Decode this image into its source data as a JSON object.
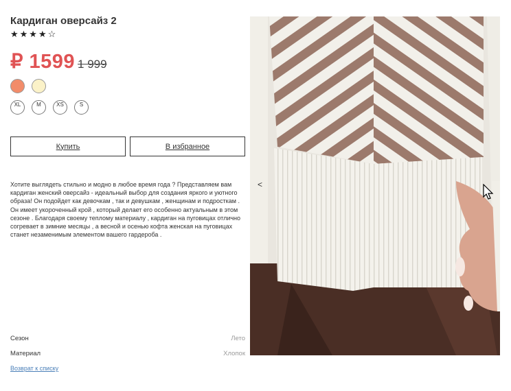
{
  "product": {
    "title": "Кардиган оверсайз 2",
    "rating_display": "★★★★☆",
    "rating": 4,
    "rating_max": 5,
    "price": "₽ 1599",
    "old_price": "1 999"
  },
  "colors": [
    {
      "name": "coral",
      "hex": "#f28c6a"
    },
    {
      "name": "cream",
      "hex": "#fbf2c8"
    }
  ],
  "sizes": [
    "XL",
    "M",
    "XS",
    "S"
  ],
  "actions": {
    "buy_label": "Купить",
    "favorite_label": "В избранное"
  },
  "description": "Хотите выглядеть стильно и модно в любое время года ? Представляем вам кардиган женский оверсайз - идеальный выбор для создания яркого и уютного образа! Он подойдет как девочкам , так и девушкам , женщинам и подросткам . Он имеет укороченный крой , который делает его особенно актуальным в этом сезоне . Благодаря своему теплому материалу , кардиган на пуговицах отлично согревает в зимние месяцы , а весной и осенью кофта женская на пуговицах станет незаменимым элементом вашего гардероба .",
  "attributes": [
    {
      "key": "Сезон",
      "value": "Лето"
    },
    {
      "key": "Материал",
      "value": "Хлопок"
    }
  ],
  "back_link": "Возврат к списку",
  "gallery": {
    "prev_label": "<",
    "image_subject": "knitted cardigan with chevron stripes",
    "colors": {
      "stripe_brown": "#9c7a6c",
      "knit_white": "#f2f0ea",
      "trousers": "#4a2e25",
      "skin": "#d9a48f"
    }
  }
}
